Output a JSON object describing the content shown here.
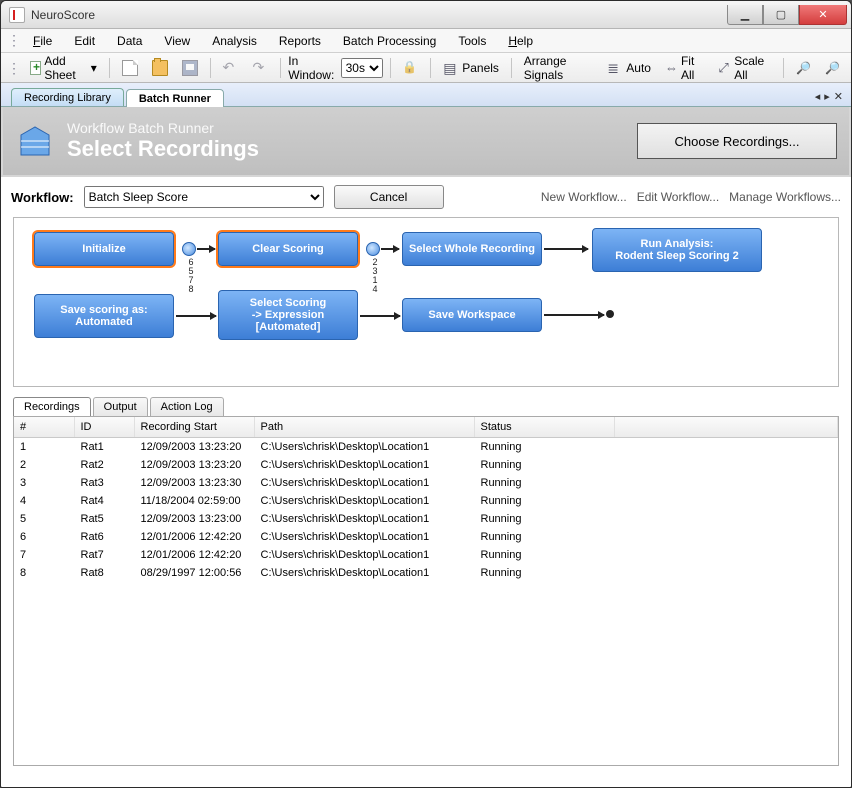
{
  "app_title": "NeuroScore",
  "menubar": [
    "File",
    "Edit",
    "Data",
    "View",
    "Analysis",
    "Reports",
    "Batch Processing",
    "Tools",
    "Help"
  ],
  "toolbar": {
    "add_sheet": "Add Sheet",
    "in_window_label": "In Window:",
    "in_window_value": "30s",
    "panels": "Panels",
    "arrange": "Arrange Signals",
    "auto": "Auto",
    "fit": "Fit All",
    "scale": "Scale All"
  },
  "tabs": {
    "library": "Recording Library",
    "runner": "Batch Runner"
  },
  "header": {
    "subtitle": "Workflow Batch Runner",
    "title": "Select Recordings",
    "choose": "Choose Recordings..."
  },
  "workflow": {
    "label": "Workflow:",
    "value": "Batch Sleep Score",
    "cancel": "Cancel",
    "new": "New Workflow...",
    "edit": "Edit Workflow...",
    "manage": "Manage Workflows..."
  },
  "nodes": {
    "init": "Initialize",
    "clear": "Clear Scoring",
    "select_whole": "Select Whole Recording",
    "run": "Run Analysis:\nRodent Sleep Scoring 2",
    "save_as": "Save scoring as:\nAutomated",
    "select_scoring": "Select Scoring\n-> Expression\n[Automated]",
    "save_ws": "Save Workspace"
  },
  "knob_labels": {
    "a": "6\n5\n7\n8",
    "b": "2\n3\n1\n4"
  },
  "lower_tabs": {
    "rec": "Recordings",
    "out": "Output",
    "log": "Action Log"
  },
  "columns": [
    "#",
    "ID",
    "Recording Start",
    "Path",
    "Status",
    ""
  ],
  "rows": [
    {
      "n": "1",
      "id": "Rat1",
      "start": "12/09/2003 13:23:20",
      "path": "C:\\Users\\chrisk\\Desktop\\Location1",
      "status": "Running"
    },
    {
      "n": "2",
      "id": "Rat2",
      "start": "12/09/2003 13:23:20",
      "path": "C:\\Users\\chrisk\\Desktop\\Location1",
      "status": "Running"
    },
    {
      "n": "3",
      "id": "Rat3",
      "start": "12/09/2003 13:23:30",
      "path": "C:\\Users\\chrisk\\Desktop\\Location1",
      "status": "Running"
    },
    {
      "n": "4",
      "id": "Rat4",
      "start": "11/18/2004 02:59:00",
      "path": "C:\\Users\\chrisk\\Desktop\\Location1",
      "status": "Running"
    },
    {
      "n": "5",
      "id": "Rat5",
      "start": "12/09/2003 13:23:00",
      "path": "C:\\Users\\chrisk\\Desktop\\Location1",
      "status": "Running"
    },
    {
      "n": "6",
      "id": "Rat6",
      "start": "12/01/2006 12:42:20",
      "path": "C:\\Users\\chrisk\\Desktop\\Location1",
      "status": "Running"
    },
    {
      "n": "7",
      "id": "Rat7",
      "start": "12/01/2006 12:42:20",
      "path": "C:\\Users\\chrisk\\Desktop\\Location1",
      "status": "Running"
    },
    {
      "n": "8",
      "id": "Rat8",
      "start": "08/29/1997 12:00:56",
      "path": "C:\\Users\\chrisk\\Desktop\\Location1",
      "status": "Running"
    }
  ]
}
